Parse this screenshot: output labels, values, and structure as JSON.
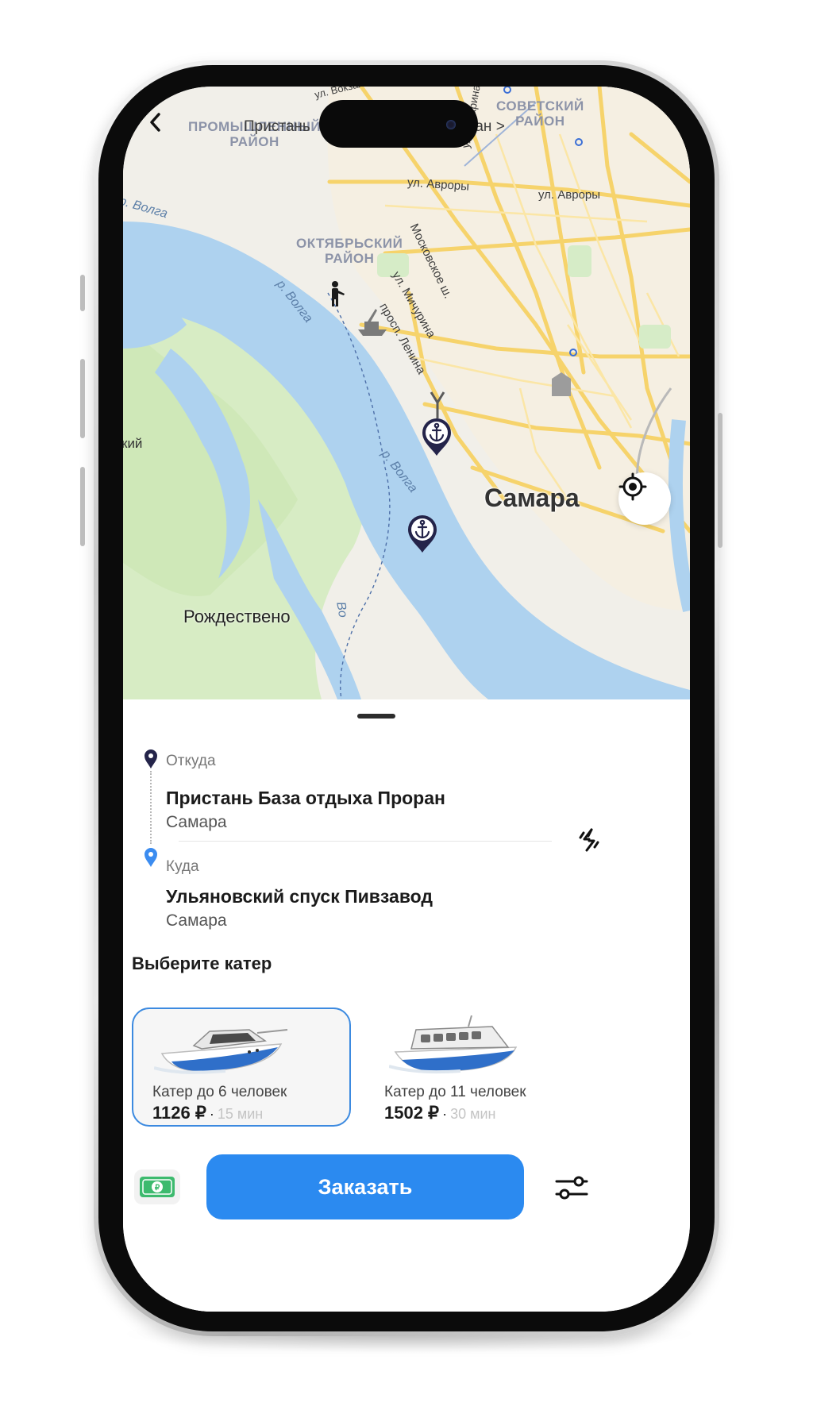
{
  "map": {
    "districts": {
      "promyshlenny": "ПРОМЫШЛЕННЫЙ\nРАЙОН",
      "sovetsky": "СОВЕТСКИЙ\nРАЙОН",
      "oktyabrsky": "ОКТЯБРЬСКИЙ\nРАЙОН"
    },
    "streets": {
      "vokzal": "ул. Вокзальная",
      "pristan": "Пристань",
      "proran": "Проран >",
      "gagarina": "ул. Гагарина",
      "avrory1": "ул. Авроры",
      "avrory2": "ул. Авроры",
      "moskovskoe": "Московское ш.",
      "michurina": "ул. Мичурина",
      "lenina": "просп. Ленина"
    },
    "rivers": {
      "volga1": "р. Волга",
      "volga2": "р. Волга",
      "volga3": "р. Волга",
      "volga4": "Во"
    },
    "partial_label": "кий",
    "city": "Самара",
    "town": "Рождествено"
  },
  "route": {
    "from_label": "Откуда",
    "from_title": "Пристань База отдыха Проран",
    "from_city": "Самара",
    "to_label": "Куда",
    "to_title": "Ульяновский спуск Пивзавод",
    "to_city": "Самара"
  },
  "boats": {
    "section_title": "Выберите катер",
    "options": [
      {
        "name": "Катер до 6 человек",
        "price": "1126 ₽",
        "time": "15 мин",
        "selected": true
      },
      {
        "name": "Катер до 11 человек",
        "price": "1502 ₽",
        "time": "30 мин",
        "selected": false
      }
    ]
  },
  "actions": {
    "order_label": "Заказать"
  },
  "colors": {
    "accent": "#2b8af0",
    "pin": "#24244a",
    "river": "#aed2ef",
    "road": "#f6d36b"
  }
}
